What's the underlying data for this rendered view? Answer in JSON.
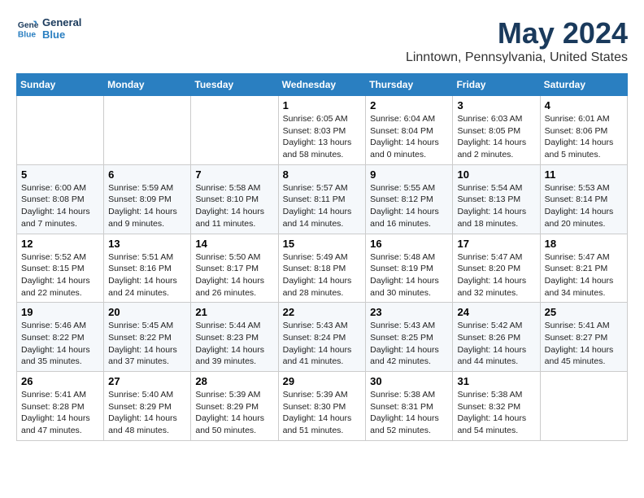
{
  "header": {
    "logo_line1": "General",
    "logo_line2": "Blue",
    "month": "May 2024",
    "location": "Linntown, Pennsylvania, United States"
  },
  "weekdays": [
    "Sunday",
    "Monday",
    "Tuesday",
    "Wednesday",
    "Thursday",
    "Friday",
    "Saturday"
  ],
  "weeks": [
    [
      {
        "day": "",
        "sunrise": "",
        "sunset": "",
        "daylight": ""
      },
      {
        "day": "",
        "sunrise": "",
        "sunset": "",
        "daylight": ""
      },
      {
        "day": "",
        "sunrise": "",
        "sunset": "",
        "daylight": ""
      },
      {
        "day": "1",
        "sunrise": "Sunrise: 6:05 AM",
        "sunset": "Sunset: 8:03 PM",
        "daylight": "Daylight: 13 hours and 58 minutes."
      },
      {
        "day": "2",
        "sunrise": "Sunrise: 6:04 AM",
        "sunset": "Sunset: 8:04 PM",
        "daylight": "Daylight: 14 hours and 0 minutes."
      },
      {
        "day": "3",
        "sunrise": "Sunrise: 6:03 AM",
        "sunset": "Sunset: 8:05 PM",
        "daylight": "Daylight: 14 hours and 2 minutes."
      },
      {
        "day": "4",
        "sunrise": "Sunrise: 6:01 AM",
        "sunset": "Sunset: 8:06 PM",
        "daylight": "Daylight: 14 hours and 5 minutes."
      }
    ],
    [
      {
        "day": "5",
        "sunrise": "Sunrise: 6:00 AM",
        "sunset": "Sunset: 8:08 PM",
        "daylight": "Daylight: 14 hours and 7 minutes."
      },
      {
        "day": "6",
        "sunrise": "Sunrise: 5:59 AM",
        "sunset": "Sunset: 8:09 PM",
        "daylight": "Daylight: 14 hours and 9 minutes."
      },
      {
        "day": "7",
        "sunrise": "Sunrise: 5:58 AM",
        "sunset": "Sunset: 8:10 PM",
        "daylight": "Daylight: 14 hours and 11 minutes."
      },
      {
        "day": "8",
        "sunrise": "Sunrise: 5:57 AM",
        "sunset": "Sunset: 8:11 PM",
        "daylight": "Daylight: 14 hours and 14 minutes."
      },
      {
        "day": "9",
        "sunrise": "Sunrise: 5:55 AM",
        "sunset": "Sunset: 8:12 PM",
        "daylight": "Daylight: 14 hours and 16 minutes."
      },
      {
        "day": "10",
        "sunrise": "Sunrise: 5:54 AM",
        "sunset": "Sunset: 8:13 PM",
        "daylight": "Daylight: 14 hours and 18 minutes."
      },
      {
        "day": "11",
        "sunrise": "Sunrise: 5:53 AM",
        "sunset": "Sunset: 8:14 PM",
        "daylight": "Daylight: 14 hours and 20 minutes."
      }
    ],
    [
      {
        "day": "12",
        "sunrise": "Sunrise: 5:52 AM",
        "sunset": "Sunset: 8:15 PM",
        "daylight": "Daylight: 14 hours and 22 minutes."
      },
      {
        "day": "13",
        "sunrise": "Sunrise: 5:51 AM",
        "sunset": "Sunset: 8:16 PM",
        "daylight": "Daylight: 14 hours and 24 minutes."
      },
      {
        "day": "14",
        "sunrise": "Sunrise: 5:50 AM",
        "sunset": "Sunset: 8:17 PM",
        "daylight": "Daylight: 14 hours and 26 minutes."
      },
      {
        "day": "15",
        "sunrise": "Sunrise: 5:49 AM",
        "sunset": "Sunset: 8:18 PM",
        "daylight": "Daylight: 14 hours and 28 minutes."
      },
      {
        "day": "16",
        "sunrise": "Sunrise: 5:48 AM",
        "sunset": "Sunset: 8:19 PM",
        "daylight": "Daylight: 14 hours and 30 minutes."
      },
      {
        "day": "17",
        "sunrise": "Sunrise: 5:47 AM",
        "sunset": "Sunset: 8:20 PM",
        "daylight": "Daylight: 14 hours and 32 minutes."
      },
      {
        "day": "18",
        "sunrise": "Sunrise: 5:47 AM",
        "sunset": "Sunset: 8:21 PM",
        "daylight": "Daylight: 14 hours and 34 minutes."
      }
    ],
    [
      {
        "day": "19",
        "sunrise": "Sunrise: 5:46 AM",
        "sunset": "Sunset: 8:22 PM",
        "daylight": "Daylight: 14 hours and 35 minutes."
      },
      {
        "day": "20",
        "sunrise": "Sunrise: 5:45 AM",
        "sunset": "Sunset: 8:22 PM",
        "daylight": "Daylight: 14 hours and 37 minutes."
      },
      {
        "day": "21",
        "sunrise": "Sunrise: 5:44 AM",
        "sunset": "Sunset: 8:23 PM",
        "daylight": "Daylight: 14 hours and 39 minutes."
      },
      {
        "day": "22",
        "sunrise": "Sunrise: 5:43 AM",
        "sunset": "Sunset: 8:24 PM",
        "daylight": "Daylight: 14 hours and 41 minutes."
      },
      {
        "day": "23",
        "sunrise": "Sunrise: 5:43 AM",
        "sunset": "Sunset: 8:25 PM",
        "daylight": "Daylight: 14 hours and 42 minutes."
      },
      {
        "day": "24",
        "sunrise": "Sunrise: 5:42 AM",
        "sunset": "Sunset: 8:26 PM",
        "daylight": "Daylight: 14 hours and 44 minutes."
      },
      {
        "day": "25",
        "sunrise": "Sunrise: 5:41 AM",
        "sunset": "Sunset: 8:27 PM",
        "daylight": "Daylight: 14 hours and 45 minutes."
      }
    ],
    [
      {
        "day": "26",
        "sunrise": "Sunrise: 5:41 AM",
        "sunset": "Sunset: 8:28 PM",
        "daylight": "Daylight: 14 hours and 47 minutes."
      },
      {
        "day": "27",
        "sunrise": "Sunrise: 5:40 AM",
        "sunset": "Sunset: 8:29 PM",
        "daylight": "Daylight: 14 hours and 48 minutes."
      },
      {
        "day": "28",
        "sunrise": "Sunrise: 5:39 AM",
        "sunset": "Sunset: 8:29 PM",
        "daylight": "Daylight: 14 hours and 50 minutes."
      },
      {
        "day": "29",
        "sunrise": "Sunrise: 5:39 AM",
        "sunset": "Sunset: 8:30 PM",
        "daylight": "Daylight: 14 hours and 51 minutes."
      },
      {
        "day": "30",
        "sunrise": "Sunrise: 5:38 AM",
        "sunset": "Sunset: 8:31 PM",
        "daylight": "Daylight: 14 hours and 52 minutes."
      },
      {
        "day": "31",
        "sunrise": "Sunrise: 5:38 AM",
        "sunset": "Sunset: 8:32 PM",
        "daylight": "Daylight: 14 hours and 54 minutes."
      },
      {
        "day": "",
        "sunrise": "",
        "sunset": "",
        "daylight": ""
      }
    ]
  ]
}
